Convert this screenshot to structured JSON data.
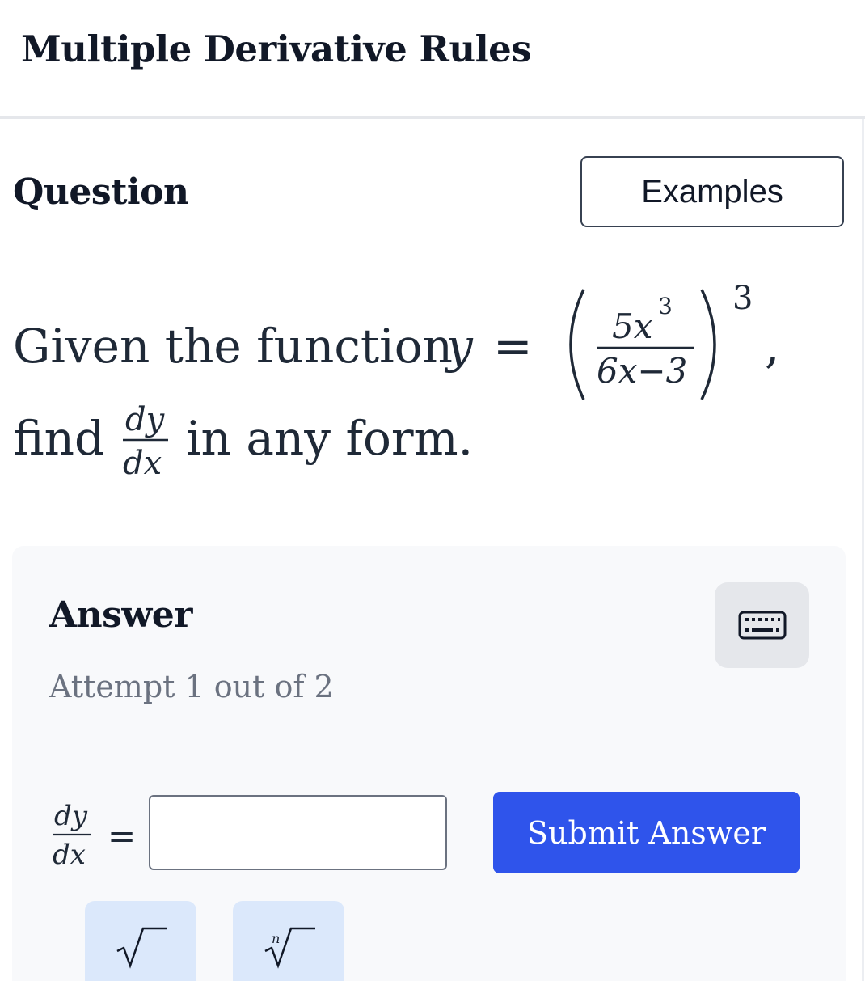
{
  "header": {
    "title": "Multiple Derivative Rules"
  },
  "question": {
    "heading": "Question",
    "examples_label": "Examples",
    "text_start": "Given the function",
    "text_find": "find",
    "text_end": "in any form.",
    "function": {
      "lhs": "y",
      "equals": "=",
      "numerator": "5x",
      "numerator_exp": "3",
      "denominator": "6x−3",
      "outer_exp": "3",
      "trailing": ","
    },
    "derivative": {
      "numerator": "dy",
      "denominator": "dx"
    }
  },
  "answer": {
    "heading": "Answer",
    "attempt_text": "Attempt 1 out of 2",
    "lhs_numerator": "dy",
    "lhs_denominator": "dx",
    "equals": "=",
    "input_value": "",
    "submit_label": "Submit Answer",
    "keyboard_icon": "keyboard-icon",
    "tools": [
      {
        "icon": "square-root-icon"
      },
      {
        "icon": "nth-root-icon"
      }
    ]
  },
  "colors": {
    "submit_bg": "#2f54eb",
    "tool_bg": "#dbe8fb",
    "panel_bg": "#f8f9fb"
  }
}
